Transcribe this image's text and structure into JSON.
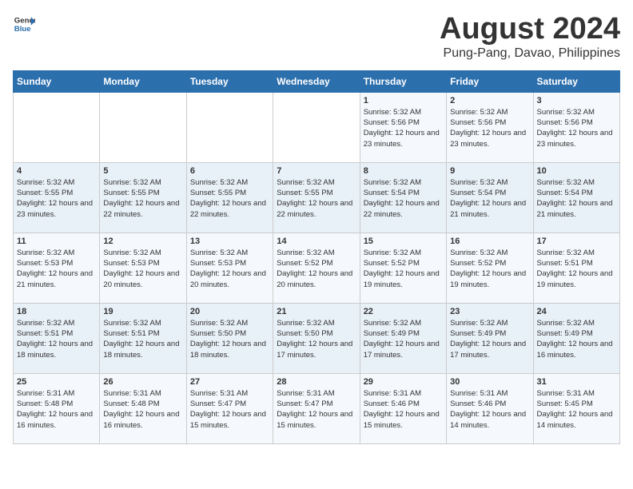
{
  "logo": {
    "general": "General",
    "blue": "Blue"
  },
  "title": {
    "month_year": "August 2024",
    "location": "Pung-Pang, Davao, Philippines"
  },
  "weekdays": [
    "Sunday",
    "Monday",
    "Tuesday",
    "Wednesday",
    "Thursday",
    "Friday",
    "Saturday"
  ],
  "weeks": [
    [
      {
        "day": "",
        "sunrise": "",
        "sunset": "",
        "daylight": ""
      },
      {
        "day": "",
        "sunrise": "",
        "sunset": "",
        "daylight": ""
      },
      {
        "day": "",
        "sunrise": "",
        "sunset": "",
        "daylight": ""
      },
      {
        "day": "",
        "sunrise": "",
        "sunset": "",
        "daylight": ""
      },
      {
        "day": "1",
        "sunrise": "Sunrise: 5:32 AM",
        "sunset": "Sunset: 5:56 PM",
        "daylight": "Daylight: 12 hours and 23 minutes."
      },
      {
        "day": "2",
        "sunrise": "Sunrise: 5:32 AM",
        "sunset": "Sunset: 5:56 PM",
        "daylight": "Daylight: 12 hours and 23 minutes."
      },
      {
        "day": "3",
        "sunrise": "Sunrise: 5:32 AM",
        "sunset": "Sunset: 5:56 PM",
        "daylight": "Daylight: 12 hours and 23 minutes."
      }
    ],
    [
      {
        "day": "4",
        "sunrise": "Sunrise: 5:32 AM",
        "sunset": "Sunset: 5:55 PM",
        "daylight": "Daylight: 12 hours and 23 minutes."
      },
      {
        "day": "5",
        "sunrise": "Sunrise: 5:32 AM",
        "sunset": "Sunset: 5:55 PM",
        "daylight": "Daylight: 12 hours and 22 minutes."
      },
      {
        "day": "6",
        "sunrise": "Sunrise: 5:32 AM",
        "sunset": "Sunset: 5:55 PM",
        "daylight": "Daylight: 12 hours and 22 minutes."
      },
      {
        "day": "7",
        "sunrise": "Sunrise: 5:32 AM",
        "sunset": "Sunset: 5:55 PM",
        "daylight": "Daylight: 12 hours and 22 minutes."
      },
      {
        "day": "8",
        "sunrise": "Sunrise: 5:32 AM",
        "sunset": "Sunset: 5:54 PM",
        "daylight": "Daylight: 12 hours and 22 minutes."
      },
      {
        "day": "9",
        "sunrise": "Sunrise: 5:32 AM",
        "sunset": "Sunset: 5:54 PM",
        "daylight": "Daylight: 12 hours and 21 minutes."
      },
      {
        "day": "10",
        "sunrise": "Sunrise: 5:32 AM",
        "sunset": "Sunset: 5:54 PM",
        "daylight": "Daylight: 12 hours and 21 minutes."
      }
    ],
    [
      {
        "day": "11",
        "sunrise": "Sunrise: 5:32 AM",
        "sunset": "Sunset: 5:53 PM",
        "daylight": "Daylight: 12 hours and 21 minutes."
      },
      {
        "day": "12",
        "sunrise": "Sunrise: 5:32 AM",
        "sunset": "Sunset: 5:53 PM",
        "daylight": "Daylight: 12 hours and 20 minutes."
      },
      {
        "day": "13",
        "sunrise": "Sunrise: 5:32 AM",
        "sunset": "Sunset: 5:53 PM",
        "daylight": "Daylight: 12 hours and 20 minutes."
      },
      {
        "day": "14",
        "sunrise": "Sunrise: 5:32 AM",
        "sunset": "Sunset: 5:52 PM",
        "daylight": "Daylight: 12 hours and 20 minutes."
      },
      {
        "day": "15",
        "sunrise": "Sunrise: 5:32 AM",
        "sunset": "Sunset: 5:52 PM",
        "daylight": "Daylight: 12 hours and 19 minutes."
      },
      {
        "day": "16",
        "sunrise": "Sunrise: 5:32 AM",
        "sunset": "Sunset: 5:52 PM",
        "daylight": "Daylight: 12 hours and 19 minutes."
      },
      {
        "day": "17",
        "sunrise": "Sunrise: 5:32 AM",
        "sunset": "Sunset: 5:51 PM",
        "daylight": "Daylight: 12 hours and 19 minutes."
      }
    ],
    [
      {
        "day": "18",
        "sunrise": "Sunrise: 5:32 AM",
        "sunset": "Sunset: 5:51 PM",
        "daylight": "Daylight: 12 hours and 18 minutes."
      },
      {
        "day": "19",
        "sunrise": "Sunrise: 5:32 AM",
        "sunset": "Sunset: 5:51 PM",
        "daylight": "Daylight: 12 hours and 18 minutes."
      },
      {
        "day": "20",
        "sunrise": "Sunrise: 5:32 AM",
        "sunset": "Sunset: 5:50 PM",
        "daylight": "Daylight: 12 hours and 18 minutes."
      },
      {
        "day": "21",
        "sunrise": "Sunrise: 5:32 AM",
        "sunset": "Sunset: 5:50 PM",
        "daylight": "Daylight: 12 hours and 17 minutes."
      },
      {
        "day": "22",
        "sunrise": "Sunrise: 5:32 AM",
        "sunset": "Sunset: 5:49 PM",
        "daylight": "Daylight: 12 hours and 17 minutes."
      },
      {
        "day": "23",
        "sunrise": "Sunrise: 5:32 AM",
        "sunset": "Sunset: 5:49 PM",
        "daylight": "Daylight: 12 hours and 17 minutes."
      },
      {
        "day": "24",
        "sunrise": "Sunrise: 5:32 AM",
        "sunset": "Sunset: 5:49 PM",
        "daylight": "Daylight: 12 hours and 16 minutes."
      }
    ],
    [
      {
        "day": "25",
        "sunrise": "Sunrise: 5:31 AM",
        "sunset": "Sunset: 5:48 PM",
        "daylight": "Daylight: 12 hours and 16 minutes."
      },
      {
        "day": "26",
        "sunrise": "Sunrise: 5:31 AM",
        "sunset": "Sunset: 5:48 PM",
        "daylight": "Daylight: 12 hours and 16 minutes."
      },
      {
        "day": "27",
        "sunrise": "Sunrise: 5:31 AM",
        "sunset": "Sunset: 5:47 PM",
        "daylight": "Daylight: 12 hours and 15 minutes."
      },
      {
        "day": "28",
        "sunrise": "Sunrise: 5:31 AM",
        "sunset": "Sunset: 5:47 PM",
        "daylight": "Daylight: 12 hours and 15 minutes."
      },
      {
        "day": "29",
        "sunrise": "Sunrise: 5:31 AM",
        "sunset": "Sunset: 5:46 PM",
        "daylight": "Daylight: 12 hours and 15 minutes."
      },
      {
        "day": "30",
        "sunrise": "Sunrise: 5:31 AM",
        "sunset": "Sunset: 5:46 PM",
        "daylight": "Daylight: 12 hours and 14 minutes."
      },
      {
        "day": "31",
        "sunrise": "Sunrise: 5:31 AM",
        "sunset": "Sunset: 5:45 PM",
        "daylight": "Daylight: 12 hours and 14 minutes."
      }
    ]
  ]
}
